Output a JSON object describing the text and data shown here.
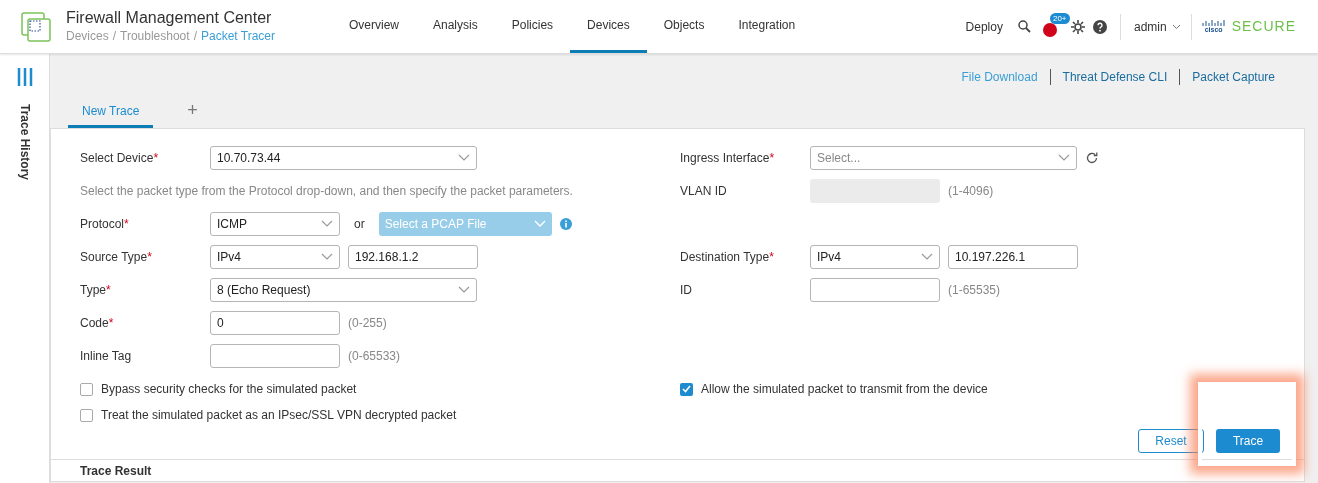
{
  "header": {
    "title": "Firewall Management Center",
    "breadcrumb": [
      {
        "label": "Devices",
        "current": false
      },
      {
        "label": "Troubleshoot",
        "current": false
      },
      {
        "label": "Packet Tracer",
        "current": true
      }
    ],
    "separator": "/",
    "nav": [
      {
        "label": "Overview",
        "selected": false
      },
      {
        "label": "Analysis",
        "selected": false
      },
      {
        "label": "Policies",
        "selected": false
      },
      {
        "label": "Devices",
        "selected": true
      },
      {
        "label": "Objects",
        "selected": false
      },
      {
        "label": "Integration",
        "selected": false
      }
    ],
    "deploy": "Deploy",
    "alert_badge": "20+",
    "user": "admin",
    "brand_small": "cisco",
    "brand": "SECURE"
  },
  "sidebar": {
    "label": "Trace History"
  },
  "links": [
    "File Download",
    "Threat Defense CLI",
    "Packet Capture"
  ],
  "tabs": [
    {
      "label": "New Trace",
      "selected": true
    },
    {
      "label": "+",
      "selected": false
    }
  ],
  "rows": [
    {
      "left": {
        "label": "Select Device",
        "required_mark": "*",
        "controls": [
          {
            "kind": "select_wide",
            "value": "10.70.73.44"
          }
        ]
      },
      "right": {
        "label": "Ingress Interface",
        "required_mark": "*",
        "controls": [
          {
            "kind": "select_wide",
            "placeholder": "Select..."
          },
          {
            "kind": "refresh"
          }
        ]
      }
    },
    {
      "left": {
        "kind": "hint",
        "text": "Select the packet type from the Protocol drop-down, and then specify the packet parameters."
      },
      "right": {
        "label": "VLAN ID",
        "controls": [
          {
            "kind": "input",
            "disabled": true
          },
          {
            "kind": "range",
            "text": "(1-4096)"
          }
        ]
      }
    },
    {
      "left": {
        "label": "Protocol",
        "required_mark": "*",
        "controls": [
          {
            "kind": "select",
            "value": "ICMP"
          },
          {
            "kind": "or",
            "text": "or"
          },
          {
            "kind": "pcap",
            "placeholder": "Select a PCAP File"
          },
          {
            "kind": "info"
          }
        ]
      }
    },
    {
      "left": {
        "label": "Source Type",
        "required_mark": "*",
        "controls": [
          {
            "kind": "select",
            "value": "IPv4"
          },
          {
            "kind": "input",
            "value": "192.168.1.2",
            "disabled": false
          }
        ]
      },
      "right": {
        "label": "Destination Type",
        "required_mark": "*",
        "controls": [
          {
            "kind": "select",
            "value": "IPv4"
          },
          {
            "kind": "input",
            "value": "10.197.226.1",
            "disabled": false
          }
        ]
      }
    },
    {
      "left": {
        "label": "Type",
        "required_mark": "*",
        "controls": [
          {
            "kind": "select_wide",
            "value": "8 (Echo Request)"
          }
        ]
      },
      "right": {
        "label": "ID",
        "controls": [
          {
            "kind": "input",
            "disabled": false
          },
          {
            "kind": "range",
            "text": "(1-65535)"
          }
        ]
      }
    },
    {
      "left": {
        "label": "Code",
        "required_mark": "*",
        "controls": [
          {
            "kind": "input",
            "value": "0",
            "disabled": false
          },
          {
            "kind": "range",
            "text": "(0-255)"
          }
        ]
      }
    },
    {
      "left": {
        "label": "Inline Tag",
        "controls": [
          {
            "kind": "input",
            "disabled": false
          },
          {
            "kind": "range",
            "text": "(0-65533)"
          }
        ]
      }
    }
  ],
  "options_left": [
    {
      "label": "Bypass security checks for the simulated packet",
      "checked": false
    },
    {
      "label": "Treat the simulated packet as an IPsec/SSL VPN decrypted packet",
      "checked": false
    }
  ],
  "options_right": [
    {
      "label": "Allow the simulated packet to transmit from the device",
      "checked": true
    }
  ],
  "buttons": [
    {
      "label": "Reset",
      "kind": "secondary",
      "highlighted": false
    },
    {
      "label": "Trace",
      "kind": "primary",
      "highlighted": true
    }
  ],
  "result": {
    "title": "Trace Result"
  }
}
